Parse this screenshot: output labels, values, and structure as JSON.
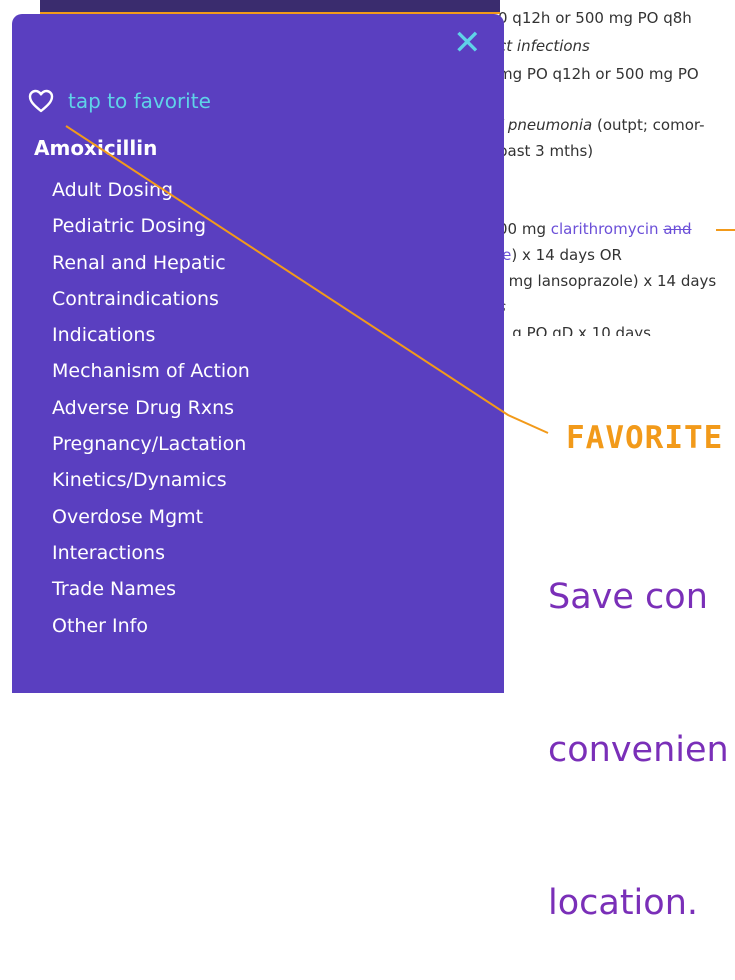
{
  "background": {
    "lines": [
      {
        "text": "0 q12h or 500 mg PO q8h",
        "style": "normal"
      },
      {
        "text": "ct infections",
        "style": "italic"
      },
      {
        "text": "mg PO q12h or 500 mg PO",
        "style": "normal"
      },
      {
        "text": "/ pneumonia (outpt; comor-",
        "style": "mixed"
      },
      {
        "text": "past 3 mths)",
        "style": "normal"
      },
      {
        "text": "00 mg ",
        "link": "clarithromycin",
        "strike": "and",
        "style": "link"
      },
      {
        "text": "le) x 14 days OR",
        "style": "mixed2"
      },
      {
        "text": ") mg lansoprazole) x 14 days",
        "style": "normal"
      },
      {
        "text": "s",
        "style": "italic"
      },
      {
        "text": "1 g PO qD x 10 days",
        "style": "normal"
      }
    ],
    "pneumonia_italic": "/ pneumonia",
    "pneumonia_rest": " (outpt; comor-",
    "le_link": "le",
    "le_rest": ") x 14 days OR"
  },
  "drawer": {
    "close_glyph": "✕",
    "favorite_label": "tap to favorite",
    "drug_name": "Amoxicillin",
    "menu": [
      "Adult Dosing",
      "Pediatric Dosing",
      "Renal and Hepatic",
      "Contraindications",
      "Indications",
      "Mechanism of Action",
      "Adverse Drug Rxns",
      "Pregnancy/Lactation",
      "Kinetics/Dynamics",
      "Overdose Mgmt",
      "Interactions",
      "Trade Names",
      "Other Info"
    ]
  },
  "callout": {
    "title": "FAVORITE",
    "body_lines": [
      "Save con",
      "convenien",
      "location."
    ]
  },
  "colors": {
    "drawer_bg": "#5a3fc0",
    "accent_cyan": "#5fd3e8",
    "callout_orange": "#f29a1a",
    "callout_text": "#7a2fb8"
  },
  "icons": {
    "close": "close-icon",
    "favorite": "heart-outline-icon"
  }
}
